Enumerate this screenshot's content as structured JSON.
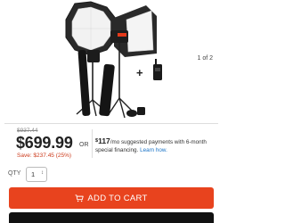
{
  "gallery": {
    "pager_text": "1 of 2",
    "image_alt": "lighting-kit-product-photo"
  },
  "price": {
    "list_price": "$937.44",
    "sale_price": "$699.99",
    "savings": "Save: $237.45 (25%)"
  },
  "financing": {
    "or_label": "OR",
    "dollar_sign": "$",
    "monthly_amount": "117",
    "per_month": "/mo",
    "text": " suggested payments with 6‑month special financing. ",
    "link_text": "Learn how."
  },
  "quantity": {
    "label": "QTY",
    "value": "1"
  },
  "cart": {
    "button_label": "ADD TO CART",
    "icon": "cart-icon"
  },
  "colors": {
    "accent": "#e8431e",
    "savings": "#cc3a1b",
    "link": "#1a73c7"
  }
}
